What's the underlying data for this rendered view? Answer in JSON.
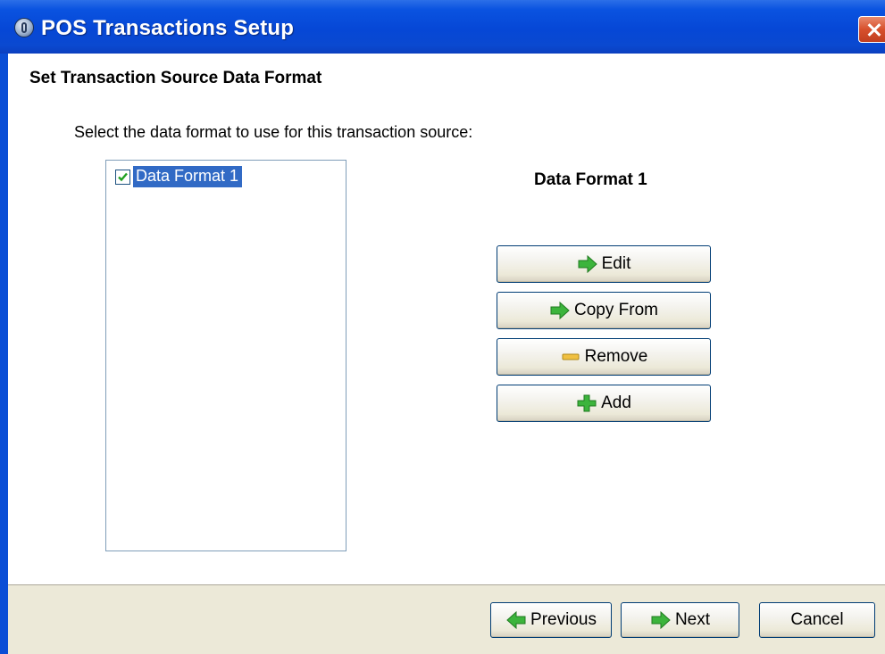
{
  "window": {
    "title": "POS Transactions Setup"
  },
  "page": {
    "heading": "Set Transaction Source Data Format",
    "instruction": "Select the data format to use for this transaction source:"
  },
  "formats_list": {
    "items": [
      {
        "label": "Data Format 1",
        "checked": true,
        "selected": true
      }
    ]
  },
  "selected_format": {
    "title": "Data Format 1"
  },
  "actions": {
    "edit": "Edit",
    "copy_from": "Copy From",
    "remove": "Remove",
    "add": "Add"
  },
  "footer": {
    "previous": "Previous",
    "next": "Next",
    "cancel": "Cancel"
  },
  "icons": {
    "title": "app-logo-icon",
    "edit": "green-arrow-right-icon",
    "copy_from": "green-arrow-right-icon",
    "remove": "minus-icon",
    "add": "plus-icon",
    "previous": "green-arrow-left-icon",
    "next": "green-arrow-right-icon"
  },
  "colors": {
    "titlebar": "#0a53e0",
    "selection": "#316ac5",
    "arrow_green": "#3cb43c",
    "minus_yellow": "#f0c040"
  }
}
